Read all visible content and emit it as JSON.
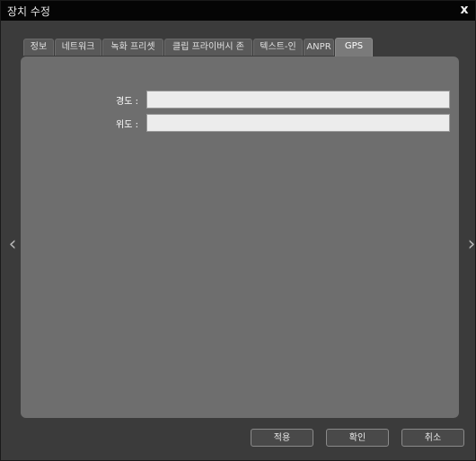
{
  "window": {
    "title": "장치 수정",
    "close_label": "x"
  },
  "tabs": [
    {
      "label": "정보",
      "active": false
    },
    {
      "label": "네트워크",
      "active": false
    },
    {
      "label": "녹화 프리셋",
      "active": false
    },
    {
      "label": "클립 프라이버시 존",
      "active": false
    },
    {
      "label": "텍스트-인",
      "active": false
    },
    {
      "label": "ANPR",
      "active": false
    },
    {
      "label": "GPS",
      "active": true
    }
  ],
  "gps": {
    "longitude_label": "경도 :",
    "longitude_value": "",
    "latitude_label": "위도 :",
    "latitude_value": ""
  },
  "nav": {
    "prev_icon": "‹",
    "next_icon": "›"
  },
  "buttons": {
    "apply": "적용",
    "ok": "확인",
    "cancel": "취소"
  }
}
